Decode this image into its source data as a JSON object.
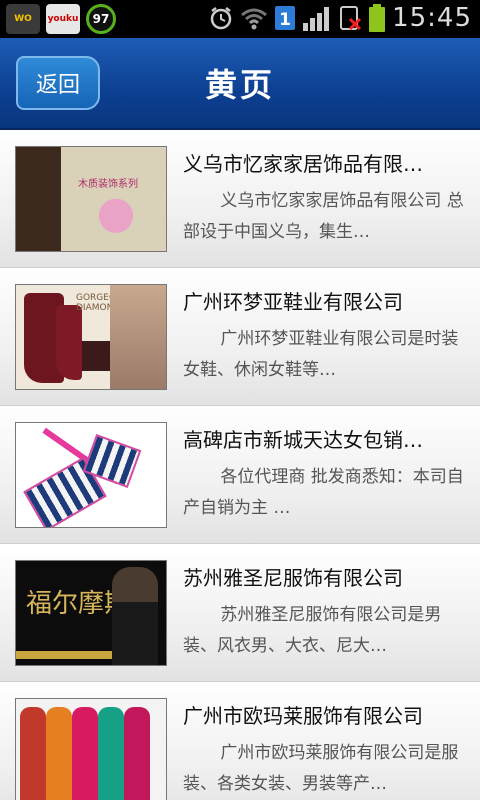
{
  "status_bar": {
    "apps": [
      "WO",
      "youku",
      "97"
    ],
    "time": "15:45"
  },
  "header": {
    "back_label": "返回",
    "title": "黄页"
  },
  "items": [
    {
      "title": "义乌市忆家家居饰品有限…",
      "desc": "义乌市忆家家居饰品有限公司 总部设于中国义乌，集生…",
      "thumb_icon": "home-decor-image"
    },
    {
      "title": "广州环梦亚鞋业有限公司",
      "desc": "广州环梦亚鞋业有限公司是时装女鞋、休闲女鞋等…",
      "thumb_icon": "boots-image"
    },
    {
      "title": "高碑店市新城天达女包销…",
      "desc": "各位代理商 批发商悉知：本司自产自销为主 …",
      "thumb_icon": "handbag-image"
    },
    {
      "title": "苏州雅圣尼服饰有限公司",
      "desc": "苏州雅圣尼服饰有限公司是男装、风衣男、大衣、尼大…",
      "thumb_icon": "menswear-image"
    },
    {
      "title": "广州市欧玛莱服饰有限公司",
      "desc": "广州市欧玛莱服饰有限公司是服装、各类女装、男装等产…",
      "thumb_icon": "womenswear-image"
    }
  ]
}
